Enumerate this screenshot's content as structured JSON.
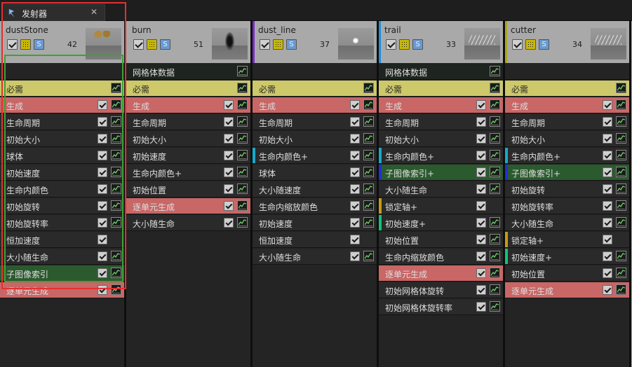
{
  "tab": {
    "title": "发射器",
    "close": "✕",
    "icon": "emitter-icon"
  },
  "colors": {
    "spawn": "#c96666",
    "required": "#cdc86a",
    "gray": "#2a2a2a",
    "green_row": "#2c5a2f",
    "accent_purple": "#7a2bc6",
    "accent_blue": "#1f8fdc",
    "accent_olive": "#a9a61f",
    "strip_cyan": "#19a8c8",
    "strip_blue": "#1c31d8",
    "strip_gold": "#c79a14",
    "strip_green": "#12c27a",
    "highlight_red": "#e53030",
    "highlight_green": "#3aa335"
  },
  "emitters": [
    {
      "name": "dustStone",
      "count": "42",
      "accent": "",
      "rows": [
        {
          "label": "",
          "style": "empty"
        },
        {
          "label": "必需",
          "style": "req",
          "check": false,
          "graph": true
        },
        {
          "label": "生成",
          "style": "spawn",
          "check": true,
          "graph": true
        },
        {
          "label": "生命周期",
          "style": "gray",
          "check": true,
          "graph": true
        },
        {
          "label": "初始大小",
          "style": "gray",
          "check": true,
          "graph": true
        },
        {
          "label": "球体",
          "style": "gray",
          "check": true,
          "graph": true
        },
        {
          "label": "初始速度",
          "style": "gray",
          "check": true,
          "graph": true
        },
        {
          "label": "生命内颜色",
          "style": "gray",
          "check": true,
          "graph": true
        },
        {
          "label": "初始旋转",
          "style": "gray",
          "check": true,
          "graph": true
        },
        {
          "label": "初始旋转率",
          "style": "gray",
          "check": true,
          "graph": true
        },
        {
          "label": "恒加速度",
          "style": "gray",
          "check": true,
          "graph": false
        },
        {
          "label": "大小随生命",
          "style": "gray",
          "check": true,
          "graph": true
        },
        {
          "label": "子图像索引",
          "style": "green",
          "check": true,
          "graph": true
        },
        {
          "label": "逐单元生成",
          "style": "spawn",
          "check": true,
          "graph": true
        }
      ]
    },
    {
      "name": "burn",
      "count": "51",
      "accent": "",
      "rows": [
        {
          "label": "网格体数据",
          "style": "dark",
          "check": false,
          "graph": true
        },
        {
          "label": "必需",
          "style": "req",
          "check": false,
          "graph": true
        },
        {
          "label": "生成",
          "style": "spawn",
          "check": true,
          "graph": true
        },
        {
          "label": "生命周期",
          "style": "gray",
          "check": true,
          "graph": true
        },
        {
          "label": "初始大小",
          "style": "gray",
          "check": true,
          "graph": true
        },
        {
          "label": "初始速度",
          "style": "gray",
          "check": true,
          "graph": true
        },
        {
          "label": "生命内颜色+",
          "style": "gray",
          "check": true,
          "graph": true
        },
        {
          "label": "初始位置",
          "style": "gray",
          "check": true,
          "graph": true
        },
        {
          "label": "逐单元生成",
          "style": "spawn",
          "check": true,
          "graph": true
        },
        {
          "label": "大小随生命",
          "style": "gray",
          "check": true,
          "graph": true
        }
      ]
    },
    {
      "name": "dust_line",
      "count": "37",
      "accent": "purple",
      "rows": [
        {
          "label": "",
          "style": "empty"
        },
        {
          "label": "必需",
          "style": "req",
          "check": false,
          "graph": true
        },
        {
          "label": "生成",
          "style": "spawn",
          "check": true,
          "graph": true
        },
        {
          "label": "生命周期",
          "style": "gray",
          "check": true,
          "graph": true
        },
        {
          "label": "初始大小",
          "style": "gray",
          "check": true,
          "graph": true
        },
        {
          "label": "生命内颜色+",
          "style": "gray",
          "check": true,
          "graph": true,
          "strip": "cyan"
        },
        {
          "label": "球体",
          "style": "gray",
          "check": true,
          "graph": true
        },
        {
          "label": "大小随速度",
          "style": "gray",
          "check": true,
          "graph": true
        },
        {
          "label": "生命内缩放颜色",
          "style": "gray",
          "check": true,
          "graph": true
        },
        {
          "label": "初始速度",
          "style": "gray",
          "check": true,
          "graph": true
        },
        {
          "label": "恒加速度",
          "style": "gray",
          "check": true,
          "graph": false
        },
        {
          "label": "大小随生命",
          "style": "gray",
          "check": true,
          "graph": true
        }
      ]
    },
    {
      "name": "trail",
      "count": "33",
      "accent": "blue",
      "rows": [
        {
          "label": "网格体数据",
          "style": "dark",
          "check": false,
          "graph": true
        },
        {
          "label": "必需",
          "style": "req",
          "check": false,
          "graph": true
        },
        {
          "label": "生成",
          "style": "spawn",
          "check": true,
          "graph": true
        },
        {
          "label": "生命周期",
          "style": "gray",
          "check": true,
          "graph": true
        },
        {
          "label": "初始大小",
          "style": "gray",
          "check": true,
          "graph": true
        },
        {
          "label": "生命内颜色+",
          "style": "gray",
          "check": true,
          "graph": true,
          "strip": "cyan"
        },
        {
          "label": "子图像索引+",
          "style": "green",
          "check": true,
          "graph": true,
          "strip": "blue"
        },
        {
          "label": "大小随生命",
          "style": "gray",
          "check": true,
          "graph": true
        },
        {
          "label": "锁定轴+",
          "style": "gray",
          "check": true,
          "graph": false,
          "strip": "gold"
        },
        {
          "label": "初始速度+",
          "style": "gray",
          "check": true,
          "graph": true,
          "strip": "green"
        },
        {
          "label": "初始位置",
          "style": "gray",
          "check": true,
          "graph": true
        },
        {
          "label": "生命内缩放颜色",
          "style": "gray",
          "check": true,
          "graph": true
        },
        {
          "label": "逐单元生成",
          "style": "spawn",
          "check": true,
          "graph": true
        },
        {
          "label": "初始网格体旋转",
          "style": "gray",
          "check": true,
          "graph": true
        },
        {
          "label": "初始网格体旋转率",
          "style": "gray",
          "check": true,
          "graph": true
        }
      ]
    },
    {
      "name": "cutter",
      "count": "34",
      "accent": "olive",
      "rows": [
        {
          "label": "",
          "style": "empty"
        },
        {
          "label": "必需",
          "style": "req",
          "check": false,
          "graph": true
        },
        {
          "label": "生成",
          "style": "spawn",
          "check": true,
          "graph": true
        },
        {
          "label": "生命周期",
          "style": "gray",
          "check": true,
          "graph": true
        },
        {
          "label": "初始大小",
          "style": "gray",
          "check": true,
          "graph": true
        },
        {
          "label": "生命内颜色+",
          "style": "gray",
          "check": true,
          "graph": true,
          "strip": "cyan"
        },
        {
          "label": "子图像索引+",
          "style": "green",
          "check": true,
          "graph": true,
          "strip": "blue"
        },
        {
          "label": "初始旋转",
          "style": "gray",
          "check": true,
          "graph": true
        },
        {
          "label": "初始旋转率",
          "style": "gray",
          "check": true,
          "graph": true
        },
        {
          "label": "大小随生命",
          "style": "gray",
          "check": true,
          "graph": true
        },
        {
          "label": "锁定轴+",
          "style": "gray",
          "check": true,
          "graph": false,
          "strip": "gold"
        },
        {
          "label": "初始速度+",
          "style": "gray",
          "check": true,
          "graph": true,
          "strip": "green"
        },
        {
          "label": "初始位置",
          "style": "gray",
          "check": true,
          "graph": true
        },
        {
          "label": "逐单元生成",
          "style": "spawn",
          "check": true,
          "graph": true
        }
      ]
    }
  ]
}
